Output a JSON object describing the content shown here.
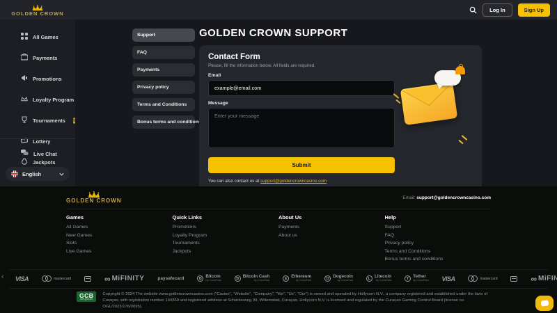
{
  "brand": {
    "name": "GOLDEN CROWN"
  },
  "header": {
    "login_label": "Log In",
    "signup_label": "Sign Up"
  },
  "sidebar": {
    "items": [
      {
        "label": "All Games",
        "icon": "grid-icon"
      },
      {
        "label": "Payments",
        "icon": "wallet-icon"
      },
      {
        "label": "Promotions",
        "icon": "megaphone-icon"
      },
      {
        "label": "Loyalty Program",
        "icon": "crown-icon"
      },
      {
        "label": "Tournaments",
        "icon": "trophy-icon",
        "badge": "coin"
      },
      {
        "label": "Lottery",
        "icon": "ticket-icon"
      },
      {
        "label": "Jackpots",
        "icon": "money-bag-icon"
      }
    ],
    "live_chat_label": "Live Chat",
    "language": "English"
  },
  "support_nav": {
    "items": [
      {
        "label": "Support",
        "active": true
      },
      {
        "label": "FAQ"
      },
      {
        "label": "Payments"
      },
      {
        "label": "Privacy policy"
      },
      {
        "label": "Terms and Conditions"
      },
      {
        "label": "Bonus terms and conditions"
      }
    ]
  },
  "main": {
    "title": "GOLDEN CROWN SUPPORT",
    "form": {
      "heading": "Contact Form",
      "subheading": "Please, fill the information below. All fields are required.",
      "email_label": "Email",
      "email_value": "example@email.com",
      "message_label": "Message",
      "message_placeholder": "Enter your message",
      "submit_label": "Submit",
      "contact_note": "You can also contact us at",
      "contact_email": "support@goldencrowncasino.com"
    }
  },
  "footer": {
    "email_label": "Email:",
    "email_value": "support@goldencrowncasino.com",
    "columns": [
      {
        "heading": "Games",
        "links": [
          "All Games",
          "New Games",
          "Slots",
          "Live Games"
        ]
      },
      {
        "heading": "Quick Links",
        "links": [
          "Promotions",
          "Loyalty Program",
          "Tournaments",
          "Jackpots"
        ]
      },
      {
        "heading": "About Us",
        "links": [
          "Payments",
          "About us"
        ]
      },
      {
        "heading": "Help",
        "links": [
          "Support",
          "FAQ",
          "Privacy policy",
          "Terms and Conditions",
          "Bonus terms and conditions"
        ]
      }
    ],
    "carousel": {
      "prev": "‹",
      "next": "›",
      "items": [
        {
          "label": "VISA"
        },
        {
          "label": "mastercard"
        },
        {
          "label": ""
        },
        {
          "label": "MiFINITY"
        },
        {
          "label": "paysafecard"
        },
        {
          "label": "Bitcoin",
          "sub": "by CoinsPaid",
          "symbol": "B"
        },
        {
          "label": "Bitcoin Cash",
          "sub": "by CoinsPaid",
          "symbol": "B"
        },
        {
          "label": "Ethereum",
          "sub": "by CoinsPaid",
          "symbol": "E"
        },
        {
          "label": "Dogecoin",
          "sub": "by CoinsPaid",
          "symbol": "D"
        },
        {
          "label": "Litecoin",
          "sub": "by CoinsPaid",
          "symbol": "L"
        },
        {
          "label": "Tether",
          "sub": "by CoinsPaid",
          "symbol": "T"
        },
        {
          "label": "VISA"
        },
        {
          "label": "mastercard"
        },
        {
          "label": ""
        },
        {
          "label": "MiFINITY"
        }
      ]
    },
    "gcb": {
      "label": "GCB",
      "sub": "cert.gcb.cw"
    },
    "copyright": "Copyright © 2024 The website www.goldencrowncasino.com (\"Casino\", \"Website\", \"Company\", \"We\", \"Us\", \"Our\") is owned and operated by Hollycorn N.V., a company registered and established under the laws of Curaçao, with registration number 144359 and registered address at Scharlooweg 39, Willemstad, Curaçao. Hollycorn N.V. is licensed and regulated by the Curaçao Gaming Control Board (license no. OGL/2023/176/0095)."
  },
  "colors": {
    "accent": "#f6c100",
    "gold": "#c9a547",
    "gcb_green": "#17652a"
  }
}
